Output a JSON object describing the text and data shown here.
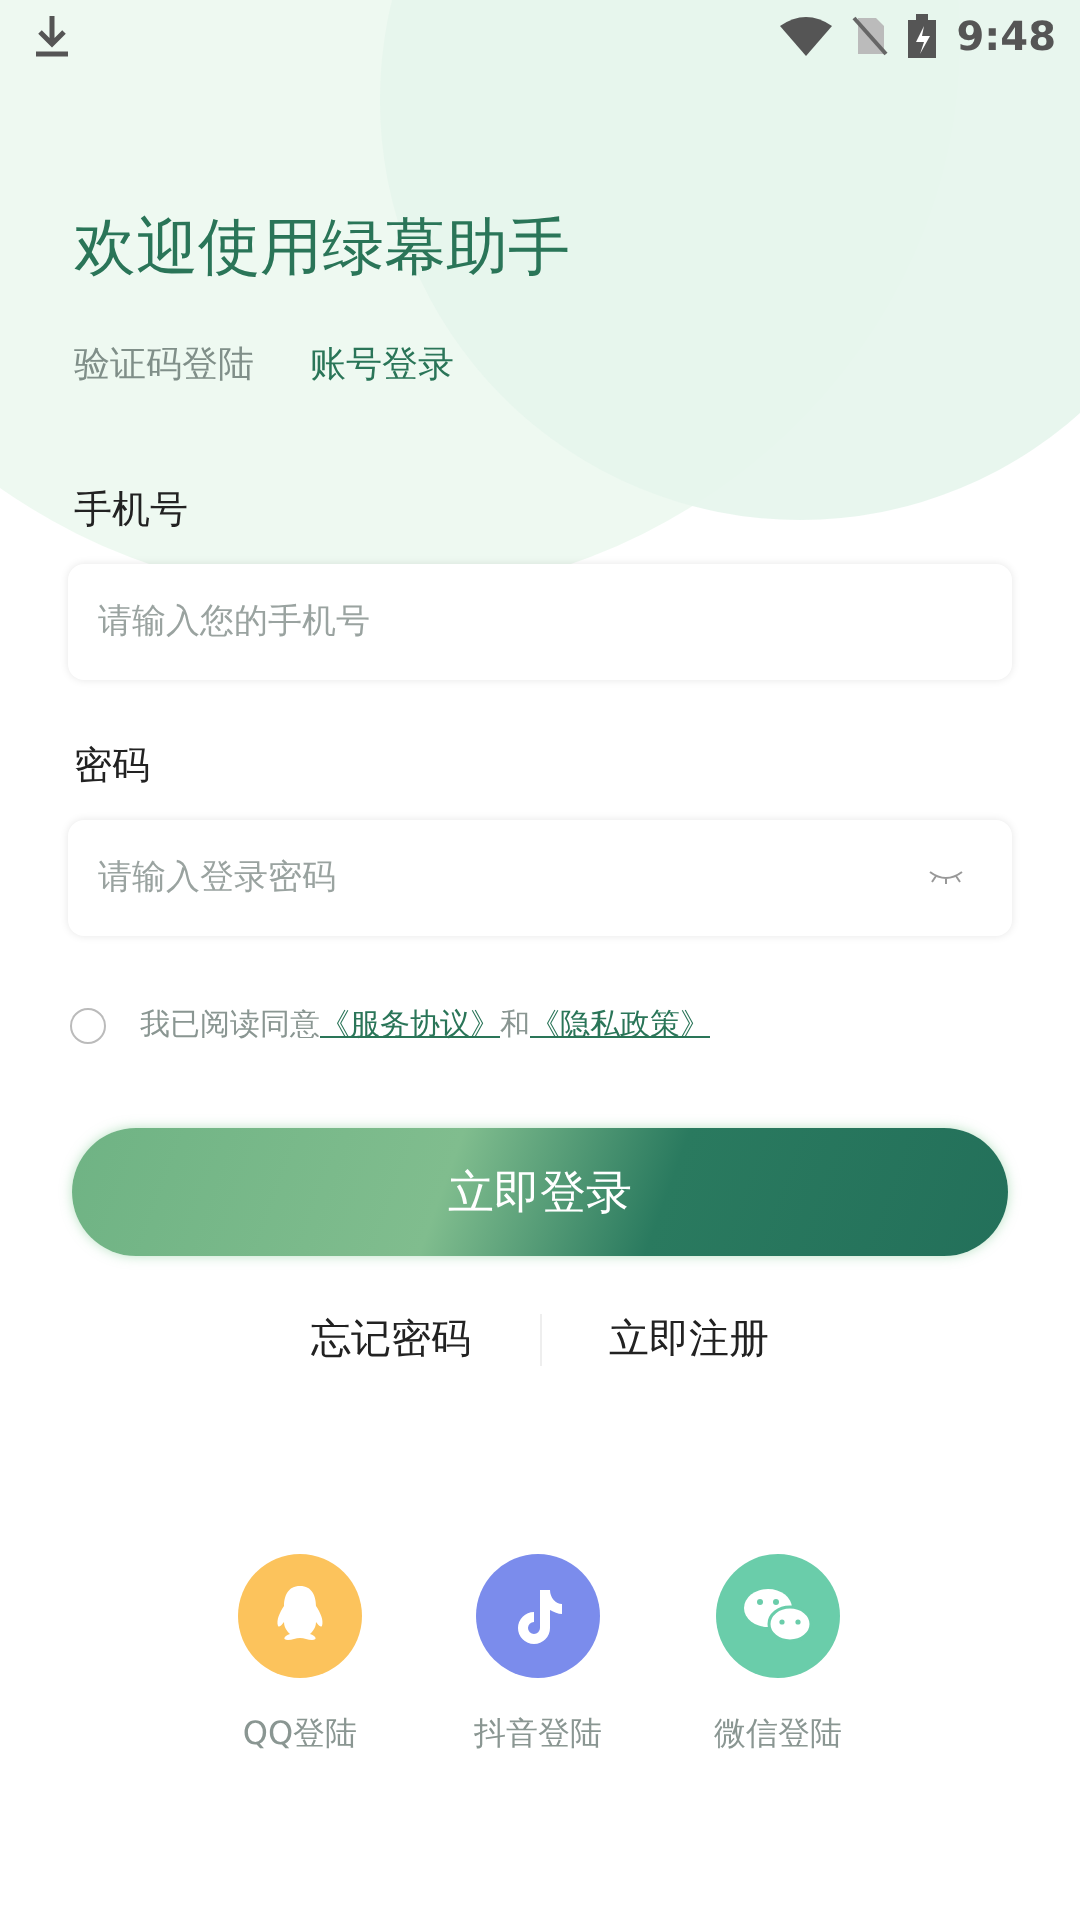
{
  "status_bar": {
    "time": "9:48"
  },
  "title": "欢迎使用绿幕助手",
  "tabs": [
    {
      "label": "验证码登陆",
      "selected": false
    },
    {
      "label": "账号登录",
      "selected": true
    }
  ],
  "fields": [
    {
      "label": "手机号",
      "placeholder": "请输入您的手机号",
      "kind": "text"
    },
    {
      "label": "密码",
      "placeholder": "请输入登录密码",
      "kind": "password"
    }
  ],
  "agreement": {
    "checked": false,
    "prefix": "我已阅读同意",
    "link_1": "《服务协议》",
    "joiner": "和",
    "link_2": "《隐私政策》"
  },
  "login_button": "立即登录",
  "links": [
    "忘记密码",
    "立即注册"
  ],
  "social": [
    {
      "kind": "qq",
      "label": "QQ登陆",
      "color": "#fcc35c"
    },
    {
      "kind": "douyin",
      "label": "抖音登陆",
      "color": "#7b8cec"
    },
    {
      "kind": "wechat",
      "label": "微信登陆",
      "color": "#6acdaa"
    }
  ]
}
